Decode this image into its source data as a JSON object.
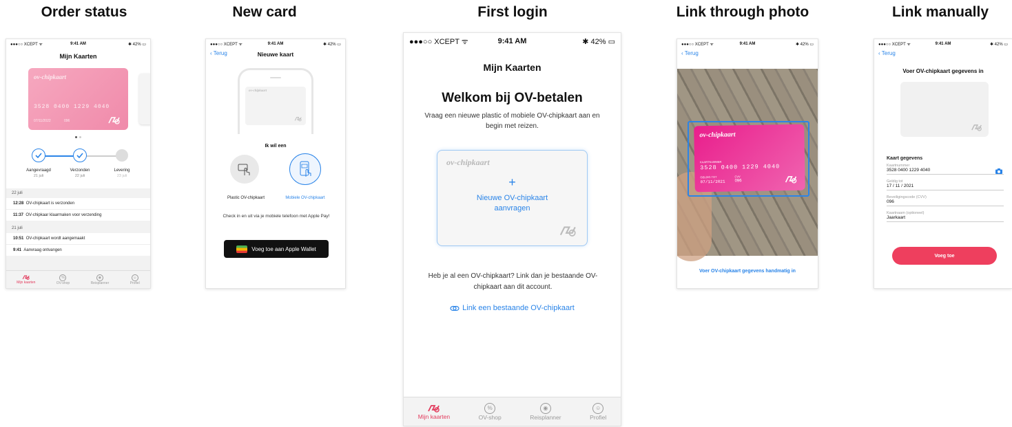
{
  "headings": [
    "Order status",
    "New card",
    "First login",
    "Link through photo",
    "Link manually"
  ],
  "status_bar": {
    "carrier": "●●●○○ XCEPT ᯤ",
    "time": "9:41 AM",
    "battery": "✱ 42% ▭"
  },
  "tabs": [
    {
      "label": "Mijn kaarten",
      "icon": "ov-card-icon"
    },
    {
      "label": "OV-shop",
      "icon": "percent-icon"
    },
    {
      "label": "Reisplanner",
      "icon": "map-pin-icon"
    },
    {
      "label": "Profiel",
      "icon": "profile-icon"
    }
  ],
  "colors": {
    "accent_pink": "#e23a5c",
    "link_blue": "#2a84e8",
    "card_pink": "#f4a0b8"
  },
  "order_status": {
    "title": "Mijn Kaarten",
    "card": {
      "logo": "ov-chipkaart",
      "number": "3528 0400 1229 4040",
      "validity": "07/11/2022",
      "cvv": "096"
    },
    "steps": [
      {
        "label": "Aangevraagd",
        "date": "21 juli"
      },
      {
        "label": "Verzonden",
        "date": "22 juli"
      },
      {
        "label": "Levering",
        "date": "23 juli"
      }
    ],
    "sections": [
      {
        "date": "22 juli",
        "events": [
          {
            "time": "12:28",
            "text": "OV-chipkaart is verzonden"
          },
          {
            "time": "11:37",
            "text": "OV-chipkaar klaarmaken voor verzending"
          }
        ]
      },
      {
        "date": "21 juli",
        "events": [
          {
            "time": "10:51",
            "text": "OV-chipkaart wordt aangemaakt"
          },
          {
            "time": "9:41",
            "text": "Aanvraag ontvangen"
          }
        ]
      }
    ]
  },
  "new_card": {
    "back": "Terug",
    "title": "Nieuwe kaart",
    "card_logo": "ov-chipkaart",
    "prompt": "Ik wil een",
    "options": [
      {
        "label": "Plastic OV-chipkaart",
        "selected": false
      },
      {
        "label": "Mobiele OV-chipkaart",
        "selected": true
      }
    ],
    "description": "Check in en uit via je mobiele telefoon met Apple Pay!",
    "wallet_button": "Voeg toe aan Apple Wallet"
  },
  "first_login": {
    "title": "Mijn Kaarten",
    "welcome": "Welkom bij OV-betalen",
    "intro": "Vraag een nieuwe plastic of mobiele OV-chipkaart aan en begin met reizen.",
    "card_logo": "ov-chipkaart",
    "plus": "+",
    "request_line1": "Nieuwe OV-chipkaart",
    "request_line2": "aanvragen",
    "existing": "Heb je al een OV-chipkaart? Link dan je bestaande OV-chipkaart aan dit account.",
    "link": "Link een bestaande OV-chipkaart"
  },
  "link_photo": {
    "back": "Terug",
    "card": {
      "logo": "ov-chipkaart",
      "number_label": "KAARTNUMMER",
      "number": "3528 0400 1229 4040",
      "valid_label": "GELDIG TOT",
      "validity": "07/11/2021",
      "cvv_label": "CVV",
      "cvv": "096"
    },
    "manual_link": "Voer OV-chipkaart gegevens handmatig in"
  },
  "link_manual": {
    "back": "Terug",
    "title": "Voer OV-chipkaart gegevens in",
    "section": "Kaart gegevens",
    "fields": [
      {
        "label": "Kaartnummer",
        "value": "3528 0400 1229 4040"
      },
      {
        "label": "Geldig tot",
        "value": "17 / 11 / 2021"
      },
      {
        "label": "Beveiligingscode (CVV)",
        "value": "096"
      },
      {
        "label": "Kaartnaam (optioneel)",
        "value": "Jaarkaart"
      }
    ],
    "submit": "Voeg toe"
  }
}
